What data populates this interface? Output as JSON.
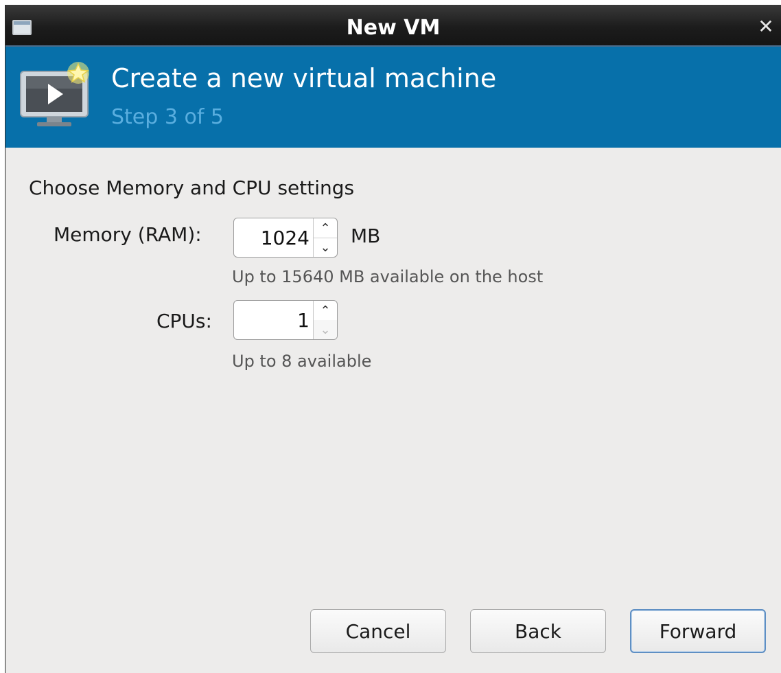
{
  "window": {
    "title": "New VM",
    "icon": "window-icon",
    "close_icon": "close-icon"
  },
  "banner": {
    "title": "Create a new virtual machine",
    "step": "Step 3 of 5",
    "icon": "vm-monitor-star-icon",
    "background_color": "#0770aa"
  },
  "content": {
    "heading": "Choose Memory and CPU settings",
    "memory": {
      "label": "Memory (RAM):",
      "value": "1024",
      "unit": "MB",
      "hint": "Up to 15640 MB available on the host"
    },
    "cpus": {
      "label": "CPUs:",
      "value": "1",
      "hint": "Up to 8 available"
    }
  },
  "footer": {
    "cancel_label": "Cancel",
    "back_label": "Back",
    "forward_label": "Forward"
  }
}
